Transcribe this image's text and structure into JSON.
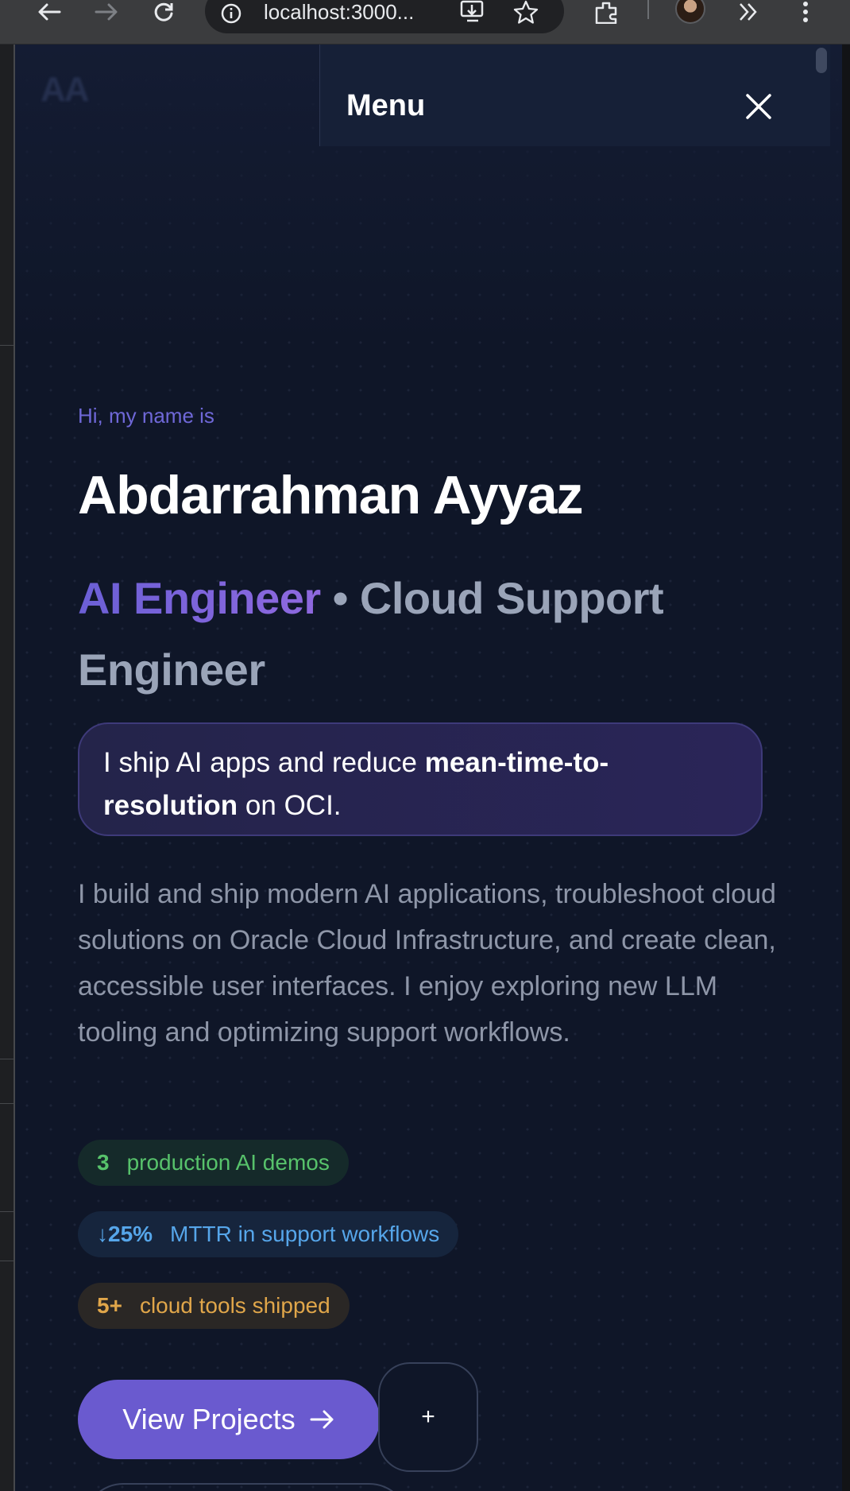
{
  "browser": {
    "url": "localhost:3000..."
  },
  "page": {
    "logo_text": "AA",
    "menu": {
      "title": "Menu"
    },
    "hero": {
      "greeting": "Hi, my name is",
      "name": "Abdarrahman Ayyaz",
      "role_accent": "AI Engineer",
      "role_rest": " • Cloud Support Engineer",
      "tagline_part1": "I ship AI apps and reduce ",
      "tagline_bold": "mean-time-to-resolution",
      "tagline_part2": " on OCI.",
      "bio": "I build and ship modern AI applications, troubleshoot cloud solutions on Oracle Cloud Infrastructure, and create clean, accessible user interfaces. I enjoy exploring new LLM tooling and optimizing support workflows.",
      "stats": [
        {
          "value": "3",
          "label": "production AI demos",
          "color": "#57c26b"
        },
        {
          "value": "↓25%",
          "label": "MTTR in support workflows",
          "color": "#56a6ea"
        },
        {
          "value": "5+",
          "label": "cloud tools shipped",
          "color": "#e0a64a"
        }
      ],
      "primary_button": "View Projects",
      "secondary_button": "+"
    }
  },
  "colors": {
    "background": "#0f1628",
    "accent": "#6a5acf"
  }
}
